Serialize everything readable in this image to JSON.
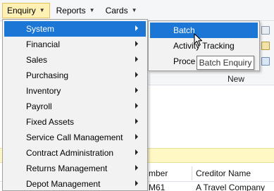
{
  "menubar": {
    "items": [
      {
        "label": "Enquiry"
      },
      {
        "label": "Reports"
      },
      {
        "label": "Cards"
      }
    ]
  },
  "enquiry_menu": {
    "items": [
      {
        "label": "System"
      },
      {
        "label": "Financial"
      },
      {
        "label": "Sales"
      },
      {
        "label": "Purchasing"
      },
      {
        "label": "Inventory"
      },
      {
        "label": "Payroll"
      },
      {
        "label": "Fixed Assets"
      },
      {
        "label": "Service Call Management"
      },
      {
        "label": "Contract Administration"
      },
      {
        "label": "Returns Management"
      },
      {
        "label": "Depot Management"
      }
    ]
  },
  "system_submenu": {
    "items": [
      {
        "label": "Batch"
      },
      {
        "label": "Activity Tracking"
      },
      {
        "label": "Proce"
      }
    ]
  },
  "tooltip": {
    "text": "Batch Enquiry"
  },
  "background": {
    "group_label": "New",
    "grid": {
      "columns": [
        "mber",
        "Creditor Name"
      ],
      "first_row": [
        "M61",
        "A Travel Company"
      ]
    }
  },
  "colors": {
    "menu_highlight": "#1c76d6",
    "active_menubar": "#fff1b3",
    "notice_strip": "#fff8c4"
  }
}
